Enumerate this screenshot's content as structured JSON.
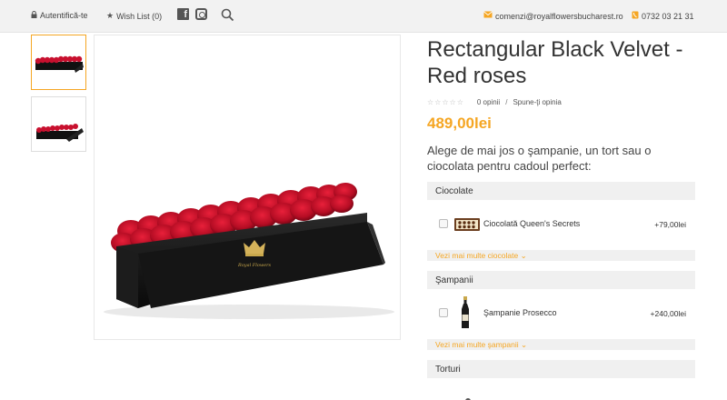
{
  "topbar": {
    "login": "Autentifică-te",
    "wishlist": "Wish List (0)",
    "email": "comenzi@royalflowersbucharest.ro",
    "phone": "0732 03 21 31",
    "facebook_icon": "facebook-icon",
    "instagram_icon": "instagram-icon",
    "search_icon": "search-icon"
  },
  "product": {
    "title": "Rectangular Black Velvet - Red roses",
    "reviews": "0 opinii",
    "review_separator": "/",
    "write_review": "Spune-ţi opinia",
    "price": "489,00lei",
    "intro": "Alege de mai jos o şampanie, un tort sau o ciocolata pentru cadoul perfect:",
    "box_logo": "Royal Flowers"
  },
  "addons": {
    "chocolate": {
      "heading": "Ciocolate",
      "item_name": "Ciocolată Queen's Secrets",
      "item_price": "+79,00lei",
      "more": "Vezi mai multe ciocolate"
    },
    "champagne": {
      "heading": "Şampanii",
      "item_name": "Şampanie Prosecco",
      "item_price": "+240,00lei",
      "more": "Vezi mai multe şampanii"
    },
    "cakes": {
      "heading": "Torturi"
    }
  },
  "colors": {
    "accent": "#f5a623",
    "velvet_box": "#111111",
    "roses": "#c8102e"
  }
}
